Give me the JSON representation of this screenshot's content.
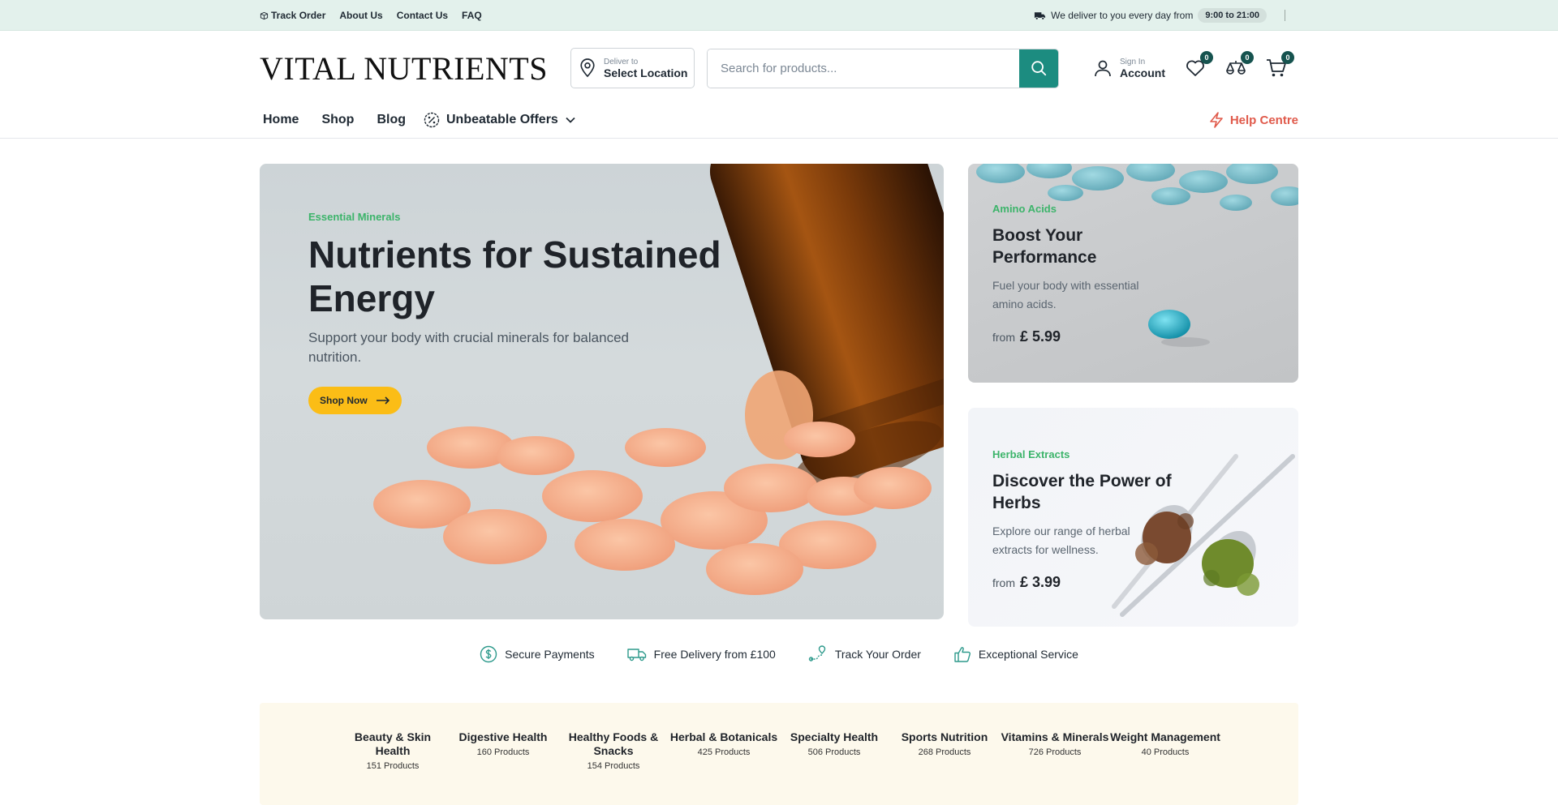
{
  "topbar": {
    "links": [
      "Track Order",
      "About Us",
      "Contact Us",
      "FAQ"
    ],
    "delivery_text": "We deliver to you every day from",
    "delivery_hours": "9:00 to 21:00"
  },
  "header": {
    "logo": "VITAL NUTRIENTS",
    "location_small": "Deliver to",
    "location_big": "Select Location",
    "search_placeholder": "Search for products...",
    "account_small": "Sign In",
    "account_big": "Account",
    "wishlist_count": "0",
    "compare_count": "0",
    "cart_count": "0"
  },
  "nav": {
    "items": [
      "Home",
      "Shop",
      "Blog"
    ],
    "offers": "Unbeatable Offers",
    "help": "Help Centre"
  },
  "hero": {
    "main": {
      "eyebrow": "Essential Minerals",
      "title": "Nutrients for Sustained Energy",
      "subtitle": "Support your body with crucial minerals for balanced nutrition.",
      "button": "Shop Now"
    },
    "side1": {
      "eyebrow": "Amino Acids",
      "title": "Boost Your Performance",
      "subtitle": "Fuel your body with essential amino acids.",
      "from": "from",
      "price": "£ 5.99"
    },
    "side2": {
      "eyebrow": "Herbal Extracts",
      "title": "Discover the Power of Herbs",
      "subtitle": "Explore our range of herbal extracts for wellness.",
      "from": "from",
      "price": "£ 3.99"
    }
  },
  "features": [
    "Secure Payments",
    "Free Delivery from £100",
    "Track Your Order",
    "Exceptional Service"
  ],
  "categories": [
    {
      "name": "Beauty & Skin Health",
      "count": "151 Products"
    },
    {
      "name": "Digestive Health",
      "count": "160 Products"
    },
    {
      "name": "Healthy Foods & Snacks",
      "count": "154 Products"
    },
    {
      "name": "Herbal & Botanicals",
      "count": "425 Products"
    },
    {
      "name": "Specialty Health",
      "count": "506 Products"
    },
    {
      "name": "Sports Nutrition",
      "count": "268 Products"
    },
    {
      "name": "Vitamins & Minerals",
      "count": "726 Products"
    },
    {
      "name": "Weight Management",
      "count": "40 Products"
    }
  ],
  "colors": {
    "topbar_bg": "#e3f1ec",
    "search_button": "#1c8c80",
    "badge": "#16534f",
    "accent_green": "#3cb46a",
    "shop_button": "#fbbd16",
    "help": "#e05a4b",
    "categories_bg": "#fdf9ec"
  }
}
